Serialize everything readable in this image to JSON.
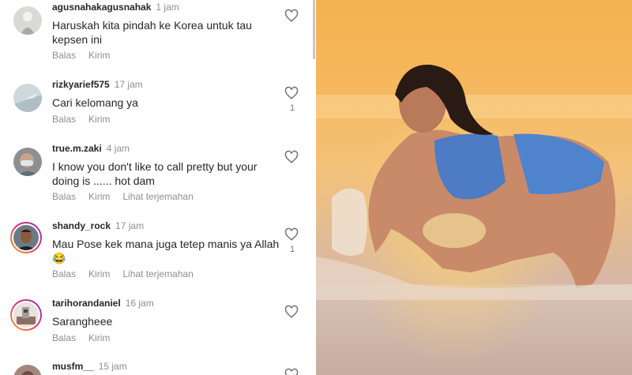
{
  "comments": [
    {
      "username": "agusnahakagusnahak",
      "time": "1 jam",
      "text": "Haruskah kita pindah ke Korea untuk tau kepsen ini",
      "reply": "Balas",
      "send": "Kirim",
      "translate": "",
      "likes": ""
    },
    {
      "username": "rizkyarief575",
      "time": "17 jam",
      "text": "Cari kelomang ya",
      "reply": "Balas",
      "send": "Kirim",
      "translate": "",
      "likes": "1"
    },
    {
      "username": "true.m.zaki",
      "time": "4 jam",
      "text": "I know you don't like to call pretty but your doing is ...... hot dam",
      "reply": "Balas",
      "send": "Kirim",
      "translate": "Lihat terjemahan",
      "likes": ""
    },
    {
      "username": "shandy_rock",
      "time": "17 jam",
      "text": "Mau Pose kek mana juga tetep manis ya Allah 😂",
      "reply": "Balas",
      "send": "Kirim",
      "translate": "Lihat terjemahan",
      "likes": "1"
    },
    {
      "username": "tarihorandaniel",
      "time": "16 jam",
      "text": "Sarangheee",
      "reply": "Balas",
      "send": "Kirim",
      "translate": "",
      "likes": ""
    },
    {
      "username": "musfm__",
      "time": "15 jam",
      "text": "",
      "reply": "",
      "send": "",
      "translate": "",
      "likes": ""
    }
  ],
  "icons": {
    "like": "heart-outline-icon"
  },
  "colors": {
    "text": "#262626",
    "secondary": "#8e8e8e",
    "story_ring": "#e1306c"
  }
}
